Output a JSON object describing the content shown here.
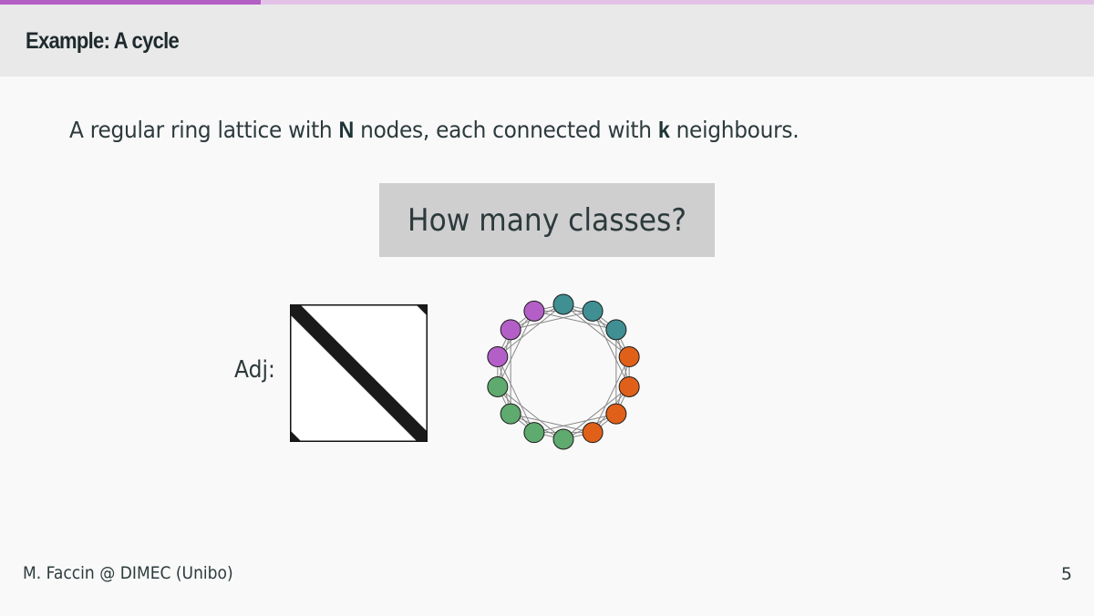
{
  "slide": {
    "progress_fraction": 0.238,
    "title": "Example: A cycle",
    "intro_prefix": "A regular ring lattice with ",
    "intro_bold_1": "N",
    "intro_middle": " nodes, each connected with ",
    "intro_bold_2": "k",
    "intro_suffix": " neighbours.",
    "question": "How many classes?",
    "adj_label": "Adj:"
  },
  "network": {
    "node_count": 14,
    "class_colors": [
      "#5faa6e",
      "#e0601a",
      "#3f8f93",
      "#b45fc8"
    ],
    "node_classes": [
      2,
      2,
      2,
      1,
      1,
      1,
      1,
      0,
      0,
      0,
      0,
      3,
      3,
      3
    ],
    "edge_color": "#888888"
  },
  "footer": {
    "author": "M. Faccin @ DIMEC (Unibo)",
    "page_number": "5"
  },
  "colors": {
    "accent": "#b25fc4",
    "accent_light": "#e3c2e8",
    "header_bg": "#e9e9e9",
    "question_bg": "#cfcfcf"
  }
}
